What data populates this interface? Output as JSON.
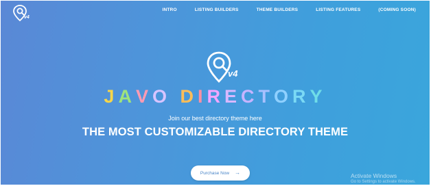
{
  "nav": {
    "items": [
      {
        "label": "INTRO"
      },
      {
        "label": "LISTING BUILDERS"
      },
      {
        "label": "THEME BUILDERS"
      },
      {
        "label": "LISTING FEATURES"
      },
      {
        "label": "(COMING SOON)"
      }
    ]
  },
  "logo": {
    "icon": "map-pin-search-icon",
    "version": "v4"
  },
  "hero": {
    "brand_letters": [
      "J",
      "A",
      "V",
      "O",
      " ",
      "D",
      "I",
      "R",
      "E",
      "C",
      "T",
      "O",
      "R",
      "Y"
    ],
    "brand_colors": [
      "#f7d64a",
      "#9ee37d",
      "#ff9bb3",
      "#d7c4ff",
      "#ffffff",
      "#ffbd59",
      "#ff8fa3",
      "#f2a6ff",
      "#d9b8ff",
      "#c6b4ff",
      "#a8c0ff",
      "#8fd0ff",
      "#7ad9f5",
      "#6fdde8"
    ],
    "tagline": "Join our best directory theme here",
    "headline": "THE MOST CUSTOMIZABLE DIRECTORY THEME",
    "purchase_label": "Purchase Now",
    "purchase_icon": "arrow-right-icon"
  },
  "watermark": {
    "title": "Activate Windows",
    "subtitle": "Go to Settings to activate Windows."
  }
}
